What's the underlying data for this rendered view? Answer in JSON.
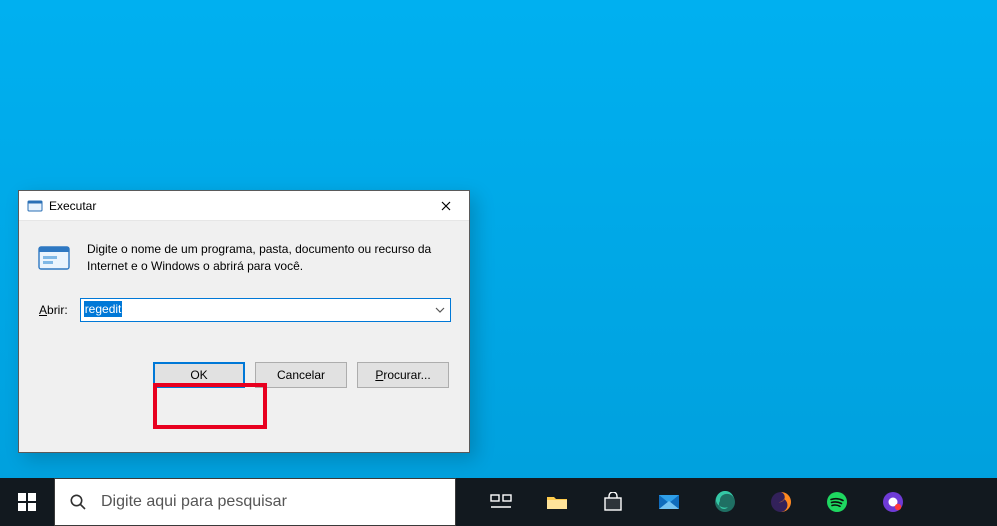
{
  "dialog": {
    "title": "Executar",
    "description": "Digite o nome de um programa, pasta, documento ou recurso da Internet e o Windows o abrirá para você.",
    "open_label_prefix": "A",
    "open_label_rest": "brir:",
    "input_value": "regedit",
    "ok_label": "OK",
    "cancel_label": "Cancelar",
    "browse_label_prefix": "P",
    "browse_label_rest": "rocurar..."
  },
  "taskbar": {
    "search_placeholder": "Digite aqui para pesquisar"
  }
}
